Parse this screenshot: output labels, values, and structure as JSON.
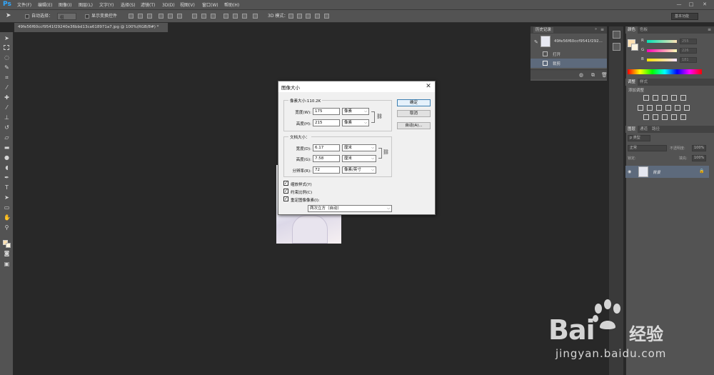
{
  "app": {
    "logo": "Ps"
  },
  "menubar": {
    "items": [
      "文件(F)",
      "编辑(E)",
      "图像(I)",
      "图层(L)",
      "文字(Y)",
      "选择(S)",
      "滤镜(T)",
      "3D(D)",
      "视图(V)",
      "窗口(W)",
      "帮助(H)"
    ],
    "window_buttons": [
      "—",
      "□",
      "✕"
    ]
  },
  "options_bar": {
    "auto_select_label": "自动选择：",
    "auto_select_value": "组",
    "show_transform_label": "显示变换控件",
    "mode_3d_label": "3D 模式：",
    "workspace": "基本功能"
  },
  "document_tab": {
    "title": "49fe56f60ccf9541f29240e36bbd13ca618971a7.jpg @ 100%(RGB/8#) *",
    "close": "×"
  },
  "history_panel": {
    "title": "历史记录",
    "snapshot_name": "49fe56f60ccf9541f292...",
    "items": [
      "打开",
      "裁剪"
    ]
  },
  "color_panel": {
    "tabs": [
      "颜色",
      "色板"
    ],
    "channels": [
      {
        "label": "R",
        "value": "255"
      },
      {
        "label": "G",
        "value": "226"
      },
      {
        "label": "B",
        "value": "181"
      }
    ]
  },
  "adjustments_panel": {
    "tabs": [
      "调整",
      "样式"
    ],
    "add_label": "添加调整"
  },
  "layers_panel": {
    "tabs": [
      "图层",
      "通道",
      "路径"
    ],
    "kind_label": "p 类型",
    "blend_mode": "正常",
    "opacity_label": "不透明度:",
    "opacity_value": "100%",
    "lock_label": "锁定:",
    "fill_label": "填充:",
    "fill_value": "100%",
    "layer_name": "背景"
  },
  "dialog": {
    "title": "图像大小",
    "close": "✕",
    "pixel_group_title": "像素大小:110.2K",
    "width_px_label": "宽度(W):",
    "width_px_value": "175",
    "width_px_unit": "像素",
    "height_px_label": "高度(H):",
    "height_px_value": "215",
    "height_px_unit": "像素",
    "doc_group_title": "文档大小：",
    "doc_width_label": "宽度(D):",
    "doc_width_value": "6.17",
    "doc_width_unit": "厘米",
    "doc_height_label": "高度(G):",
    "doc_height_value": "7.58",
    "doc_height_unit": "厘米",
    "resolution_label": "分辨率(R):",
    "resolution_value": "72",
    "resolution_unit": "像素/英寸",
    "ok_button": "确定",
    "cancel_button": "取消",
    "auto_button": "自动(A)...",
    "scale_styles_label": "缩放样式(Y)",
    "constrain_label": "约束比例(C)",
    "resample_label": "重定图像像素(I):",
    "resample_method": "两次立方（自动）",
    "checked_mark": "✓"
  },
  "watermark": {
    "brand": "Bai",
    "brand_suffix": "经验",
    "url": "jingyan.baidu.com"
  }
}
